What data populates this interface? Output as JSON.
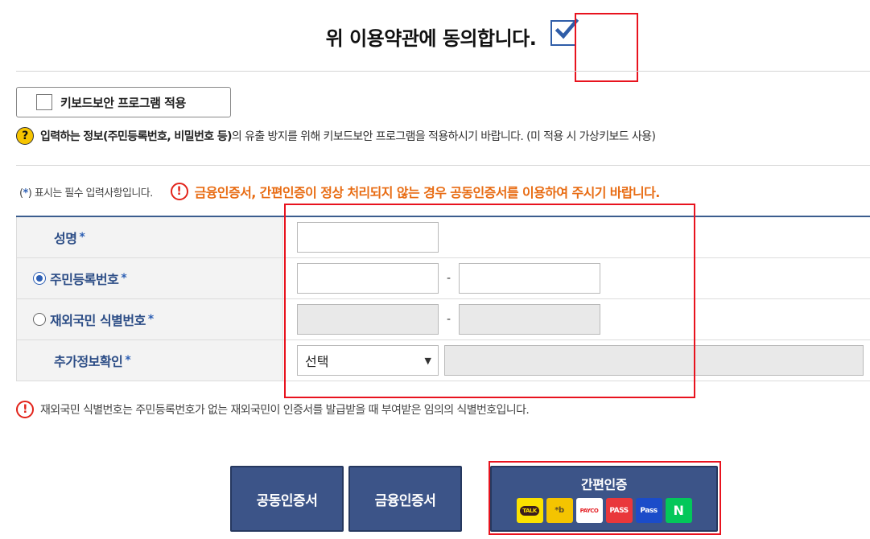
{
  "agree": {
    "text": "위 이용약관에 동의합니다.",
    "checked": true
  },
  "keyboard_security": {
    "label": "키보드보안 프로그램 적용",
    "checked": false
  },
  "help": {
    "icon": "?",
    "bold": "입력하는 정보(주민등록번호, 비밀번호 등)",
    "text": "의 유출 방지를 위해 키보드보안 프로그램을 적용하시기 바랍니다. (미 적용 시 가상키보드 사용)"
  },
  "notice": {
    "req_prefix": "(",
    "req_star": "*",
    "req_suffix": ") 표시는 필수 입력사항입니다.",
    "warn_icon": "!",
    "warn_text": "금융인증서, 간편인증이 정상 처리되지 않는 경우 공동인증서를 이용하여 주시기 바랍니다."
  },
  "form": {
    "star": "*",
    "name_label": "성명",
    "rrn_label": "주민등록번호",
    "foreign_label": "재외국민 식별번호",
    "extra_label": "추가정보확인",
    "dash": "-",
    "select_value": "선택",
    "select_arrow": "▼"
  },
  "foot_note": {
    "icon": "!",
    "text": "재외국민 식별번호는 주민등록번호가 없는 재외국민이 인증서를 발급받을 때 부여받은 임의의 식별번호입니다."
  },
  "buttons": {
    "public_cert": "공동인증서",
    "finance_cert": "금융인증서",
    "easy_auth": "간편인증"
  },
  "brands": {
    "kakao": "TALK",
    "kb": "*b",
    "payco": "PAYCO",
    "pass": "PASS",
    "samsung_pass": "Pass",
    "naver": "N"
  },
  "colors": {
    "accent_blue": "#2c4d86",
    "button_blue": "#3c5488",
    "warning_orange": "#e86c13",
    "highlight_red": "#e8131e"
  }
}
